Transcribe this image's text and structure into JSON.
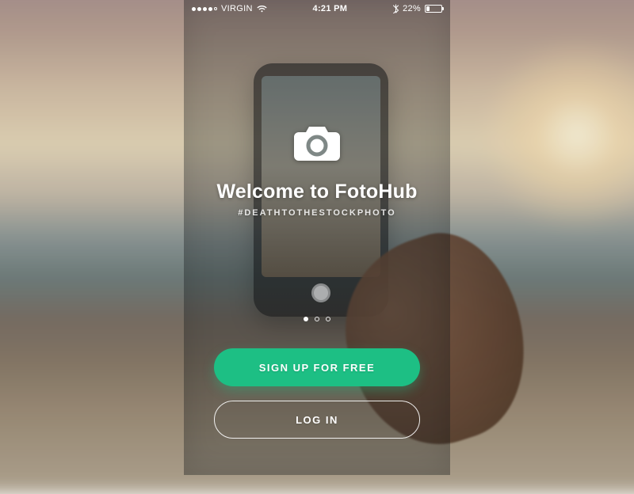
{
  "status_bar": {
    "carrier": "VIRGIN",
    "signal_filled": 4,
    "signal_total": 5,
    "time": "4:21 PM",
    "battery_percent": "22%"
  },
  "hero": {
    "title": "Welcome to FotoHub",
    "tagline": "#DEATHTOTHESTOCKPHOTO"
  },
  "pagination": {
    "count": 3,
    "active_index": 0
  },
  "actions": {
    "signup_label": "SIGN UP FOR FREE",
    "login_label": "LOG IN"
  },
  "colors": {
    "accent": "#1dbf84"
  }
}
